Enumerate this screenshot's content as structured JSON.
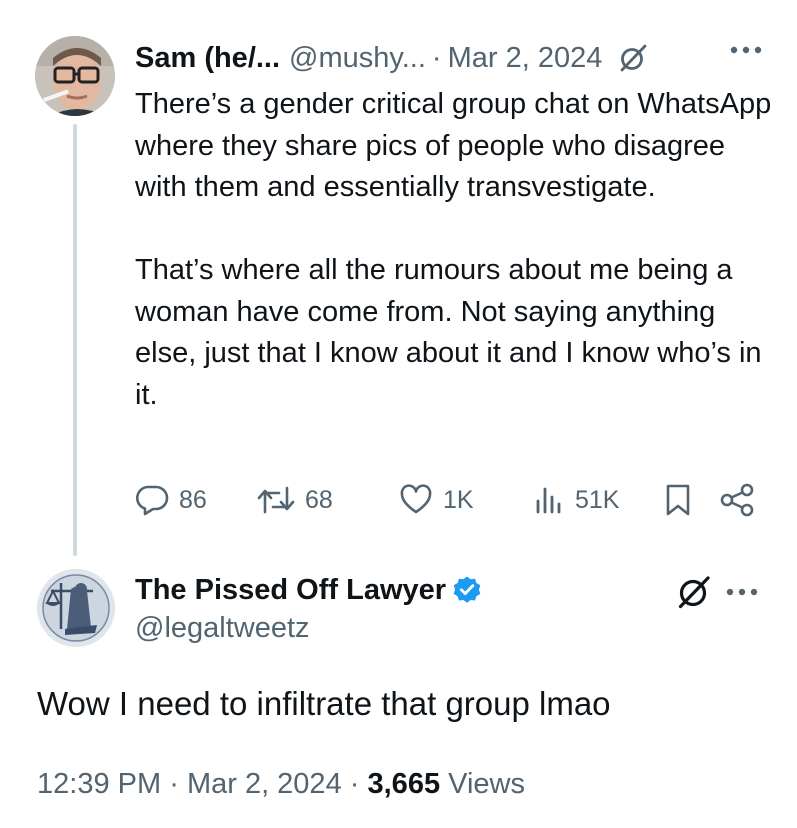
{
  "parent_tweet": {
    "author_name": "Sam (he/...",
    "handle": "@mushy...",
    "separator": "·",
    "date": "Mar 2, 2024",
    "paragraphs": [
      "There’s a gender critical group chat on WhatsApp where they share pics of people who disagree with them and essentially transvestigate.",
      "That’s where all the rumours about me being a woman have come from. Not saying anything else, just that I know about it and I know who’s in it."
    ],
    "stats": {
      "replies": "86",
      "reposts": "68",
      "likes": "1K",
      "views": "51K"
    },
    "icons": [
      "grok-icon",
      "more-icon",
      "reply-icon",
      "repost-icon",
      "like-icon",
      "views-icon",
      "bookmark-icon",
      "share-icon"
    ]
  },
  "main_tweet": {
    "author_name": "The Pissed Off Lawyer",
    "handle": "@legaltweetz",
    "text": "Wow I need to infiltrate that group lmao",
    "time": "12:39 PM",
    "date": "Mar 2, 2024",
    "separator": "·",
    "views_count": "3,665",
    "views_label": "Views",
    "verified": true,
    "icons": [
      "verified-badge-icon",
      "grok-icon",
      "more-icon"
    ]
  },
  "colors": {
    "text": "#0f1419",
    "muted": "#536471",
    "thread_line": "#cfd9de",
    "verified": "#1d9bf0"
  }
}
